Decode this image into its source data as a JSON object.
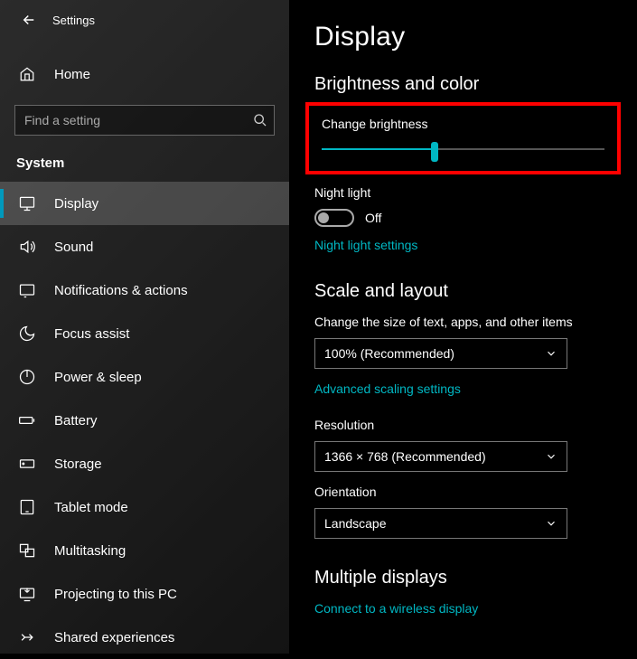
{
  "app_title": "Settings",
  "home_label": "Home",
  "search_placeholder": "Find a setting",
  "section_label": "System",
  "nav": [
    {
      "label": "Display"
    },
    {
      "label": "Sound"
    },
    {
      "label": "Notifications & actions"
    },
    {
      "label": "Focus assist"
    },
    {
      "label": "Power & sleep"
    },
    {
      "label": "Battery"
    },
    {
      "label": "Storage"
    },
    {
      "label": "Tablet mode"
    },
    {
      "label": "Multitasking"
    },
    {
      "label": "Projecting to this PC"
    },
    {
      "label": "Shared experiences"
    }
  ],
  "page_heading": "Display",
  "brightness_section": "Brightness and color",
  "change_brightness_label": "Change brightness",
  "brightness_value": 40,
  "night_light_label": "Night light",
  "night_light_state": "Off",
  "night_light_settings_link": "Night light settings",
  "scale_section": "Scale and layout",
  "scale_label": "Change the size of text, apps, and other items",
  "scale_value": "100% (Recommended)",
  "advanced_scaling_link": "Advanced scaling settings",
  "resolution_label": "Resolution",
  "resolution_value": "1366 × 768 (Recommended)",
  "orientation_label": "Orientation",
  "orientation_value": "Landscape",
  "multiple_displays_section": "Multiple displays",
  "connect_wireless_link": "Connect to a wireless display"
}
